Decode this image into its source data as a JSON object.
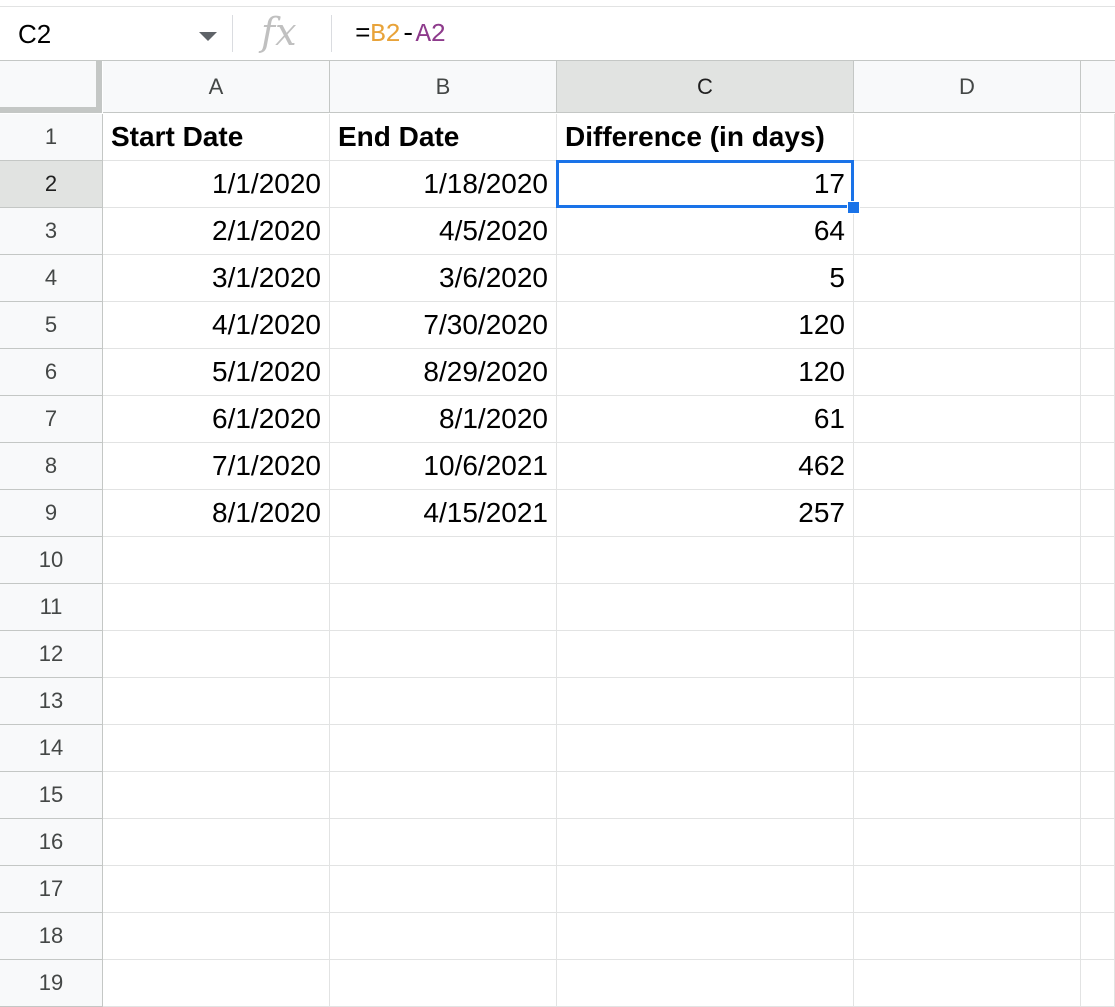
{
  "formula_bar": {
    "name_box": "C2",
    "fx_label": "fx",
    "formula": {
      "eq": "=",
      "ref1": "B2",
      "op": "-",
      "ref2": "A2"
    }
  },
  "columns": [
    "A",
    "B",
    "C",
    "D"
  ],
  "selected_column": "C",
  "row_numbers": [
    "1",
    "2",
    "3",
    "4",
    "5",
    "6",
    "7",
    "8",
    "9",
    "10",
    "11",
    "12",
    "13",
    "14",
    "15",
    "16",
    "17",
    "18",
    "19"
  ],
  "selected_row": "2",
  "selected_cell": "C2",
  "headers": {
    "A": "Start Date",
    "B": "End Date",
    "C": "Difference (in days)"
  },
  "rows": [
    {
      "A": "1/1/2020",
      "B": "1/18/2020",
      "C": "17"
    },
    {
      "A": "2/1/2020",
      "B": "4/5/2020",
      "C": "64"
    },
    {
      "A": "3/1/2020",
      "B": "3/6/2020",
      "C": "5"
    },
    {
      "A": "4/1/2020",
      "B": "7/30/2020",
      "C": "120"
    },
    {
      "A": "5/1/2020",
      "B": "8/29/2020",
      "C": "120"
    },
    {
      "A": "6/1/2020",
      "B": "8/1/2020",
      "C": "61"
    },
    {
      "A": "7/1/2020",
      "B": "10/6/2021",
      "C": "462"
    },
    {
      "A": "8/1/2020",
      "B": "4/15/2021",
      "C": "257"
    }
  ],
  "colors": {
    "selection": "#1a73e8",
    "ref1": "#e8a33a",
    "ref2": "#8e3b8c",
    "header_bg": "#f8f9fa",
    "header_selected_bg": "#e1e3e1"
  }
}
